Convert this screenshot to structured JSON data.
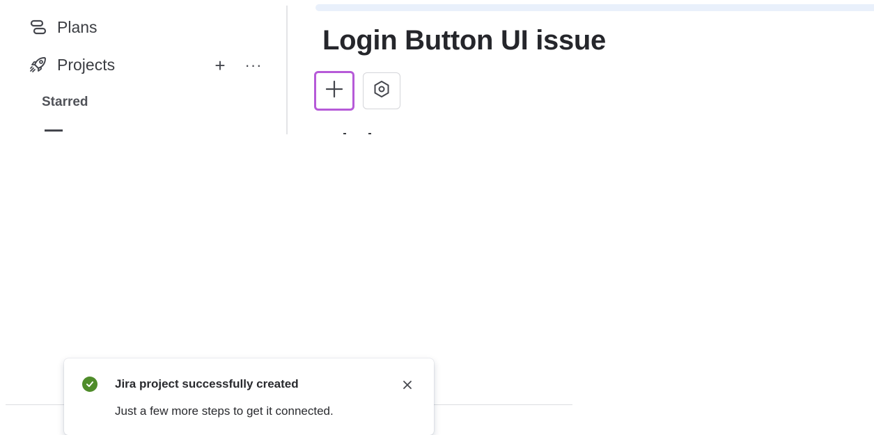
{
  "sidebar": {
    "items": [
      {
        "label": "Plans",
        "icon": "plans-icon"
      },
      {
        "label": "Projects",
        "icon": "rocket-icon"
      }
    ],
    "projects_actions": {
      "add": "+",
      "more": "···"
    },
    "section_starred": "Starred"
  },
  "main": {
    "title": "Login Button UI issue",
    "buttons": [
      {
        "name": "add-button",
        "icon": "plus-icon"
      },
      {
        "name": "settings-button",
        "icon": "hexagon-settings-icon"
      }
    ]
  },
  "toast": {
    "title": "Jira project successfully created",
    "description": "Just a few more steps to get it connected.",
    "status_icon": "success-check-icon",
    "close_icon": "close-icon"
  },
  "colors": {
    "accent_focus": "#b65ad8",
    "success": "#4f8c2a",
    "top_bar": "#e9f0fb"
  }
}
